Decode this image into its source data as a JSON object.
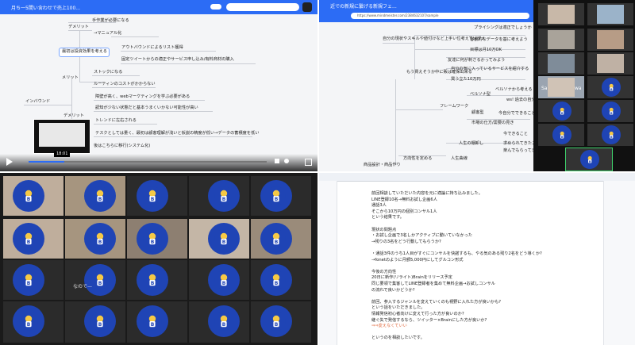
{
  "q1": {
    "tab_title": "月ち一5間い含わせで売上100...",
    "nodes": {
      "n1": "手作業が必要になる",
      "n2": "デメリット",
      "n3": "→マニュアル化",
      "n4": "最初は投資効果を考える",
      "n5": "アウトバウンドによるリスト獲得",
      "n6": "固定ツイートからの適正やサービス申し込み/有料商材の購入",
      "n7": "メリット",
      "n8": "ストックになる",
      "n9": "ルーティンのコストがかからない",
      "n10": "インバウンド",
      "n11": "障壁が高く、webマーケティングを学ぶ必要がある",
      "n12": "認知が少ない状態だと基本うまくいかない可能性が高い",
      "n13": "デメリット",
      "n14": "トレンドに左右される",
      "n15": "テスクとしては量く、最初は顧客理解が浅いと仮説の精度が低い→データの蓄積度を低い",
      "n16": "後はこちらに移行(システム化)",
      "left_label": "ウ流入"
    },
    "video_time": "18:01"
  },
  "q2": {
    "tab_title": "近での新規に繋げる新規フェ...",
    "url": "https://www.mindmeister.com/2384632107/sample",
    "nodes": {
      "a1": "プライシングは適正でしょうか",
      "a2": "自分の現状やスキルや値付けなど上手い位考えてはダメ",
      "a3": "客観的なデータを基に考えよう",
      "a4": "目標は月10万OK",
      "a5": "友達に何が刺さるかってみよう",
      "a6": "もう買えそうか中に販は確保出来る",
      "a7": "自分の気に入っているサービスを紹介する",
      "a8": "買う立た10万円",
      "a9": "ベルソナから考える",
      "a10": "フレームワーク",
      "a11": "ベルソナ型",
      "a12": "ws! 過去の自分",
      "a13": "顧客型",
      "a14": "今自分でできることは",
      "a15": "市場の仕方/需要の見き",
      "a16": "人生の棚卸し",
      "a17": "今できること",
      "a18": "求められてきたこと",
      "a19": "楽んでもらってきたこと",
      "a20": "方向性を定める",
      "a21": "人生曲線",
      "a22": "商品設計・商品作り"
    },
    "participants": [
      "Sa",
      "wa"
    ]
  },
  "q3": {
    "caption": "なので—"
  },
  "q4": {
    "lines": [
      "前回相談していただいた内容を元に適論に持ち込みました。",
      "LINE登録10名→無料お試し企画6人",
      "通話3人",
      "そこから10万円の個別コンサル1人",
      "という結果です。",
      "",
      "現状の問題点",
      "・お試し企画で3名しかアクティブに動いていなかった",
      "→残りの3名をどう行動してもらうか?",
      "",
      "・通話3件のうち1人目がすぐにコンサルを快諾するも、やる気のある残り2名をどう導くか?",
      "→fonetのように月額5,000円にしてグルコン形式",
      "",
      "今後の方向性",
      "20日に新作(リライト)Brainをリリース予定",
      "同じ要領で集客してLINE登録者を集めて無料企画→お試しコンサル",
      "の流れで良いかどうか?",
      "",
      "前回、参入するジャンルを変えていくのも視野に入れた方が良いかも?",
      "という話をいただきました。",
      "情報発信初心者向けに変えて行った方が良いのか?",
      "継ぐ失で発信するなら、ツイッター×Brainにした方が良いか?",
      "⇒⇒変えなくていい",
      "",
      "というのを相談したいです。"
    ]
  }
}
